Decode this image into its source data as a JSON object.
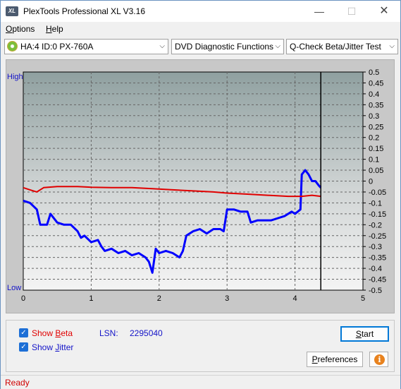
{
  "window": {
    "app_icon": "XL",
    "title": "PlexTools Professional XL V3.16",
    "minimize": "—",
    "maximize": "☐",
    "close": "✕"
  },
  "menu": [
    {
      "label": "Options",
      "accel": "O",
      "rest": "ptions"
    },
    {
      "label": "Help",
      "accel": "H",
      "rest": "elp"
    }
  ],
  "toolbar": {
    "drive": "HA:4 ID:0  PX-760A",
    "function": "DVD Diagnostic Functions",
    "test": "Q-Check Beta/Jitter Test",
    "arrow": "⌵"
  },
  "chart_data": {
    "type": "line",
    "left_axis_top_label": "High",
    "left_axis_bottom_label": "Low",
    "xlim": [
      0,
      5
    ],
    "x_ticks": [
      "0",
      "1",
      "2",
      "3",
      "4",
      "5"
    ],
    "ylim": [
      -0.5,
      0.5
    ],
    "y_ticks": [
      "0.5",
      "0.45",
      "0.4",
      "0.35",
      "0.3",
      "0.25",
      "0.2",
      "0.15",
      "0.1",
      "0.05",
      "0",
      "-0.05",
      "-0.1",
      "-0.15",
      "-0.2",
      "-0.25",
      "-0.3",
      "-0.35",
      "-0.4",
      "-0.45",
      "-0.5"
    ],
    "grid": true,
    "cursor_x": 4.38,
    "series": [
      {
        "id": "jitter",
        "color": "#0000ff",
        "points": [
          [
            0,
            -0.09
          ],
          [
            0.1,
            -0.1
          ],
          [
            0.2,
            -0.13
          ],
          [
            0.25,
            -0.2
          ],
          [
            0.35,
            -0.2
          ],
          [
            0.4,
            -0.15
          ],
          [
            0.5,
            -0.19
          ],
          [
            0.6,
            -0.2
          ],
          [
            0.7,
            -0.2
          ],
          [
            0.8,
            -0.23
          ],
          [
            0.85,
            -0.26
          ],
          [
            0.9,
            -0.25
          ],
          [
            1.0,
            -0.28
          ],
          [
            1.1,
            -0.27
          ],
          [
            1.15,
            -0.3
          ],
          [
            1.2,
            -0.32
          ],
          [
            1.3,
            -0.31
          ],
          [
            1.4,
            -0.33
          ],
          [
            1.5,
            -0.32
          ],
          [
            1.6,
            -0.34
          ],
          [
            1.7,
            -0.33
          ],
          [
            1.8,
            -0.35
          ],
          [
            1.85,
            -0.37
          ],
          [
            1.9,
            -0.42
          ],
          [
            1.95,
            -0.31
          ],
          [
            2.0,
            -0.33
          ],
          [
            2.1,
            -0.32
          ],
          [
            2.2,
            -0.33
          ],
          [
            2.3,
            -0.35
          ],
          [
            2.35,
            -0.32
          ],
          [
            2.4,
            -0.25
          ],
          [
            2.5,
            -0.23
          ],
          [
            2.6,
            -0.22
          ],
          [
            2.7,
            -0.24
          ],
          [
            2.8,
            -0.22
          ],
          [
            2.9,
            -0.22
          ],
          [
            2.95,
            -0.23
          ],
          [
            3.0,
            -0.13
          ],
          [
            3.1,
            -0.13
          ],
          [
            3.2,
            -0.14
          ],
          [
            3.3,
            -0.14
          ],
          [
            3.35,
            -0.19
          ],
          [
            3.45,
            -0.18
          ],
          [
            3.55,
            -0.18
          ],
          [
            3.65,
            -0.18
          ],
          [
            3.75,
            -0.17
          ],
          [
            3.85,
            -0.16
          ],
          [
            3.95,
            -0.14
          ],
          [
            4.0,
            -0.15
          ],
          [
            4.08,
            -0.13
          ],
          [
            4.1,
            0.03
          ],
          [
            4.15,
            0.05
          ],
          [
            4.2,
            0.03
          ],
          [
            4.25,
            -0.0
          ],
          [
            4.3,
            0.0
          ],
          [
            4.35,
            -0.02
          ],
          [
            4.38,
            -0.03
          ]
        ]
      },
      {
        "id": "beta",
        "color": "#e00000",
        "points": [
          [
            0,
            -0.03
          ],
          [
            0.1,
            -0.04
          ],
          [
            0.2,
            -0.05
          ],
          [
            0.3,
            -0.03
          ],
          [
            0.5,
            -0.025
          ],
          [
            0.8,
            -0.025
          ],
          [
            1.0,
            -0.028
          ],
          [
            1.3,
            -0.03
          ],
          [
            1.6,
            -0.03
          ],
          [
            1.9,
            -0.035
          ],
          [
            2.2,
            -0.04
          ],
          [
            2.5,
            -0.045
          ],
          [
            2.8,
            -0.05
          ],
          [
            3.0,
            -0.055
          ],
          [
            3.3,
            -0.06
          ],
          [
            3.6,
            -0.065
          ],
          [
            3.9,
            -0.07
          ],
          [
            4.1,
            -0.07
          ],
          [
            4.25,
            -0.065
          ],
          [
            4.38,
            -0.07
          ]
        ]
      }
    ]
  },
  "controls": {
    "show_beta_pre": "Show ",
    "show_beta_accel": "B",
    "show_beta_post": "eta",
    "show_jitter_pre": "Show ",
    "show_jitter_accel": "J",
    "show_jitter_post": "itter",
    "checkmark": "✓",
    "lsn_label": "LSN:",
    "lsn_value": "2295040",
    "start_accel": "S",
    "start_rest": "tart",
    "prefs_accel": "P",
    "prefs_rest": "references",
    "info_symbol": "i"
  },
  "status": {
    "text": "Ready"
  },
  "colors": {
    "beta_label": "#e00000",
    "jitter_label": "#1414c8",
    "lsn": "#1414c8"
  }
}
